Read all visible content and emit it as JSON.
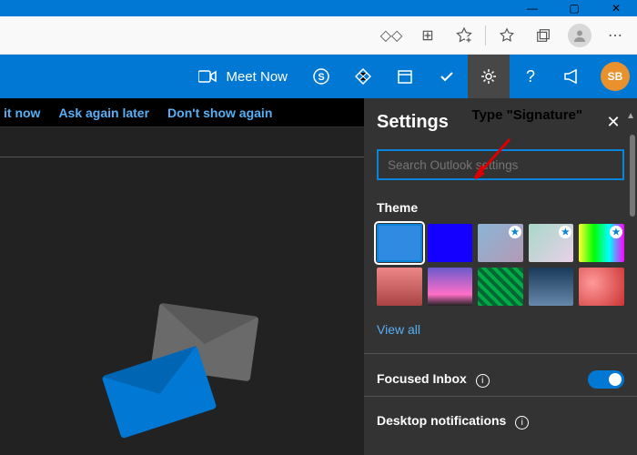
{
  "window": {
    "minimize": "—",
    "maximize": "▢",
    "close": "✕"
  },
  "edge": {
    "ext_icon": "◇◇",
    "store_icon": "⊞",
    "fav_add_icon": "⭐",
    "favorites_icon": "☆",
    "collections_icon": "⧉",
    "menu_icon": "⋯"
  },
  "owa": {
    "meet_now": "Meet Now",
    "avatar_initials": "SB"
  },
  "notice": {
    "try_now": "it now",
    "ask_later": "Ask again later",
    "dont_show": "Don't show again"
  },
  "settings": {
    "title": "Settings",
    "search_placeholder": "Search Outlook settings",
    "theme_label": "Theme",
    "view_all": "View all",
    "focused_inbox": "Focused Inbox",
    "desktop_notifications": "Desktop notifications",
    "themes": [
      {
        "bg": "#2f8ae2",
        "selected": true,
        "premium": false
      },
      {
        "bg": "#1300ff",
        "selected": false,
        "premium": false
      },
      {
        "bg": "linear-gradient(135deg,#8ab5d6,#b49ab5)",
        "selected": false,
        "premium": true
      },
      {
        "bg": "linear-gradient(135deg,#a8d8c8,#e8d0e8)",
        "selected": false,
        "premium": true
      },
      {
        "bg": "linear-gradient(90deg,#ff3,#0f0,#0ff,#f0f)",
        "selected": false,
        "premium": true
      },
      {
        "bg": "linear-gradient(#e88,#a44)",
        "selected": false,
        "premium": false
      },
      {
        "bg": "linear-gradient(#6a5acd,#ff6ec7 70%,#222)",
        "selected": false,
        "premium": false
      },
      {
        "bg": "repeating-linear-gradient(45deg,#0a4,#0a4 4px,#063 4px,#063 8px)",
        "selected": false,
        "premium": false
      },
      {
        "bg": "linear-gradient(#1a3a5a,#6688aa)",
        "selected": false,
        "premium": false
      },
      {
        "bg": "radial-gradient(circle at 30% 40%,#f99,#c33)",
        "selected": false,
        "premium": false
      }
    ]
  },
  "annotation": {
    "text": "Type \"Signature\""
  }
}
